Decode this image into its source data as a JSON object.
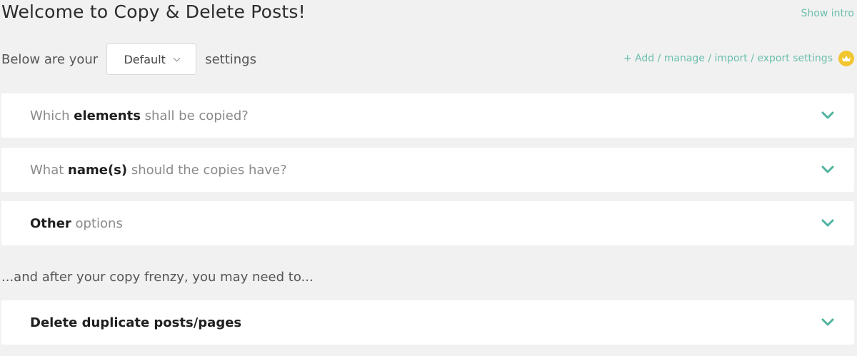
{
  "header": {
    "title": "Welcome to Copy & Delete Posts!",
    "show_intro": "Show intro"
  },
  "settings": {
    "prefix": "Below are your",
    "selected": "Default",
    "suffix": "settings",
    "manage_link": "+ Add / manage / import / export settings",
    "crown_icon": "crown-icon"
  },
  "panels": [
    {
      "pre": "Which ",
      "bold": "elements",
      "post": " shall be copied?"
    },
    {
      "pre": "What ",
      "bold": "name(s)",
      "post": " should the copies have?"
    },
    {
      "pre": "",
      "bold": "Other",
      "post": " options"
    }
  ],
  "after_text": "...and after your copy frenzy, you may need to...",
  "delete_panel": {
    "title": "Delete duplicate posts/pages"
  },
  "colors": {
    "accent": "#6cbfae",
    "chevron": "#4fb3a0",
    "crown": "#f2c62f",
    "background": "#f1f1f1"
  }
}
